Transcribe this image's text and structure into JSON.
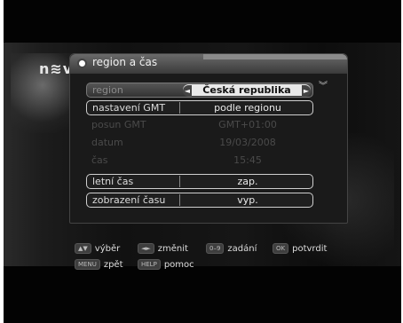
{
  "channel_logo": "n≋v",
  "menu": {
    "title": "region a čas",
    "rows": [
      {
        "label": "region",
        "value": "Česká republika"
      },
      {
        "label": "nastavení GMT",
        "value": "podle regionu"
      },
      {
        "label": "posun GMT",
        "value": "GMT+01:00"
      },
      {
        "label": "datum",
        "value": "19/03/2008"
      },
      {
        "label": "čas",
        "value": "15:45"
      },
      {
        "label": "letní čas",
        "value": "zap."
      },
      {
        "label": "zobrazení času",
        "value": "vyp."
      }
    ]
  },
  "legend": {
    "select": {
      "key": "▲▼",
      "label": "výběr"
    },
    "change": {
      "key": "◄►",
      "label": "změnit"
    },
    "input": {
      "key": "0–9",
      "label": "zadání"
    },
    "confirm": {
      "key": "OK",
      "label": "potvrdit"
    },
    "back": {
      "key": "MENU",
      "label": "zpět"
    },
    "help": {
      "key": "HELP",
      "label": "pomoc"
    }
  },
  "colors": {
    "selected_value_bg": "#e9e9e9",
    "panel_bg": "#1a1a1a",
    "dim_text": "#4a4a4a"
  }
}
